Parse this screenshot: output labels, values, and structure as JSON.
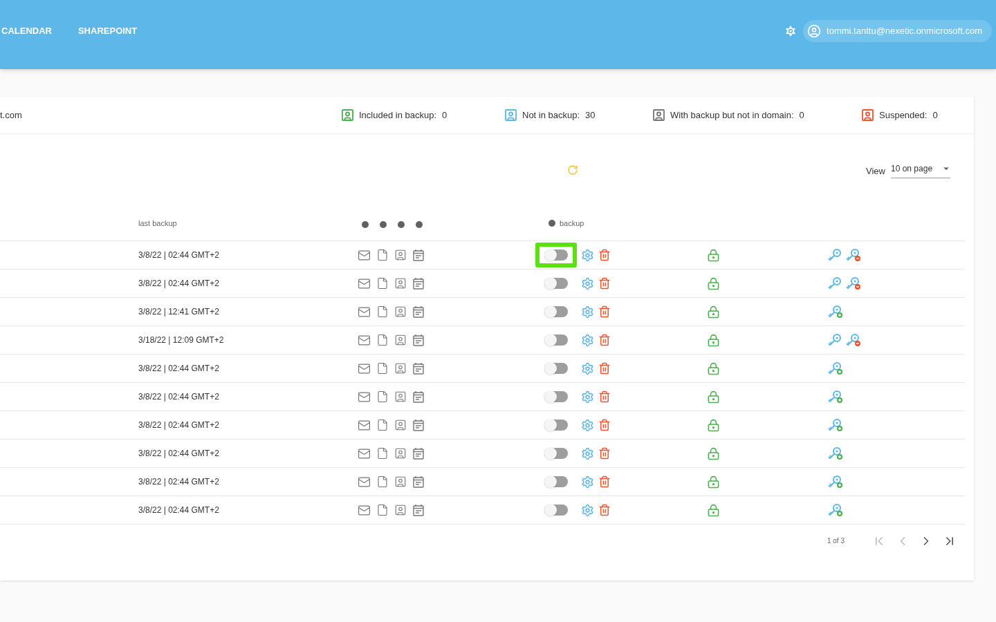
{
  "header": {
    "nav": [
      {
        "label": "CALENDAR"
      },
      {
        "label": "SHAREPOINT"
      }
    ],
    "account": "tommi.tanttu@nexetic.onmicrosoft.com"
  },
  "stats": {
    "domain": "t.com",
    "items": [
      {
        "label": "Included in backup:",
        "count": "0",
        "color": "#4caf50"
      },
      {
        "label": "Not in backup:",
        "count": "30",
        "color": "#5db7e8"
      },
      {
        "label": "With backup but not in domain:",
        "count": "0",
        "color": "#757575"
      },
      {
        "label": "Suspended:",
        "count": "0",
        "color": "#f0522d"
      }
    ]
  },
  "toolbar": {
    "view_label": "View",
    "page_size": "10 on page"
  },
  "table": {
    "columns": {
      "last_backup": "last backup",
      "backup": "backup"
    },
    "rows": [
      {
        "last_backup": "3/8/22 | 02:44 GMT+2",
        "on": false,
        "highlighted": true,
        "kind": "manage"
      },
      {
        "last_backup": "3/8/22 | 02:44 GMT+2",
        "on": false,
        "highlighted": false,
        "kind": "manage"
      },
      {
        "last_backup": "3/8/22 | 12:41 GMT+2",
        "on": false,
        "highlighted": false,
        "kind": "add"
      },
      {
        "last_backup": "3/18/22 | 12:09 GMT+2",
        "on": false,
        "highlighted": false,
        "kind": "manage"
      },
      {
        "last_backup": "3/8/22 | 02:44 GMT+2",
        "on": false,
        "highlighted": false,
        "kind": "add"
      },
      {
        "last_backup": "3/8/22 | 02:44 GMT+2",
        "on": false,
        "highlighted": false,
        "kind": "add"
      },
      {
        "last_backup": "3/8/22 | 02:44 GMT+2",
        "on": false,
        "highlighted": false,
        "kind": "add"
      },
      {
        "last_backup": "3/8/22 | 02:44 GMT+2",
        "on": false,
        "highlighted": false,
        "kind": "add"
      },
      {
        "last_backup": "3/8/22 | 02:44 GMT+2",
        "on": false,
        "highlighted": false,
        "kind": "add"
      },
      {
        "last_backup": "3/8/22 | 02:44 GMT+2",
        "on": false,
        "highlighted": false,
        "kind": "add"
      }
    ]
  },
  "pagination": {
    "page": "1 of 3",
    "buttons": [
      {
        "kind": "first",
        "disabled": true
      },
      {
        "kind": "prev",
        "disabled": true
      },
      {
        "kind": "next",
        "disabled": false
      },
      {
        "kind": "last",
        "disabled": false
      }
    ]
  }
}
